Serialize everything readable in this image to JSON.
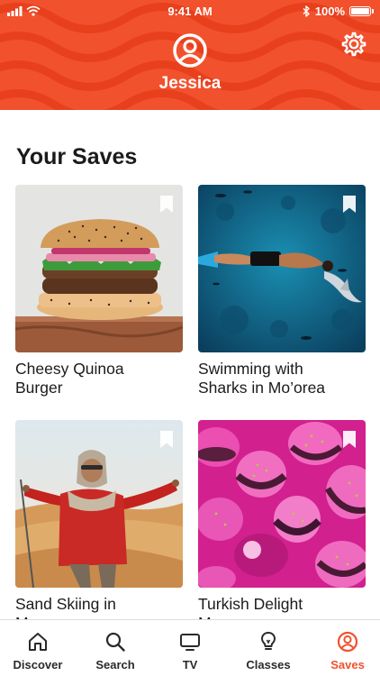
{
  "status_bar": {
    "time": "9:41 AM",
    "battery": "100%"
  },
  "profile": {
    "name": "Jessica"
  },
  "colors": {
    "brand": "#f2512d",
    "text": "#1b1b1b"
  },
  "saves": {
    "heading": "Your Saves",
    "items": [
      {
        "title": "Cheesy Quinoa Burger",
        "line1": "Cheesy Quinoa",
        "line2": "Burger",
        "image": "burger"
      },
      {
        "title": "Swimming with Sharks in Mo’orea",
        "line1": "Swimming with",
        "line2": "Sharks in Mo’orea",
        "image": "shark-swimmer"
      },
      {
        "title": "Sand Skiing in Morocco",
        "line1": "Sand Skiing in",
        "line2": "Morocco",
        "image": "desert-skier"
      },
      {
        "title": "Turkish Delight Macarons",
        "line1": "Turkish Delight",
        "line2": "Macarons",
        "image": "pink-macarons"
      }
    ]
  },
  "tabs": [
    {
      "label": "Discover",
      "icon": "home-icon"
    },
    {
      "label": "Search",
      "icon": "search-icon"
    },
    {
      "label": "TV",
      "icon": "tv-icon"
    },
    {
      "label": "Classes",
      "icon": "lightbulb-icon"
    },
    {
      "label": "Saves",
      "icon": "profile-icon",
      "active": true
    }
  ]
}
